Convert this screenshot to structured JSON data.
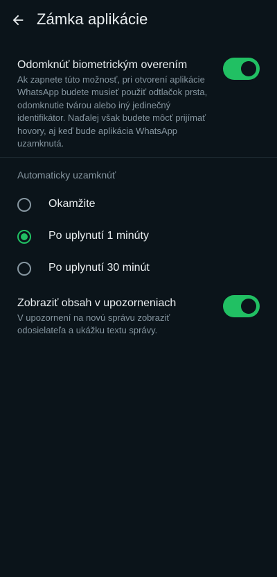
{
  "appbar": {
    "back_icon": "arrow-back-icon",
    "title": "Zámka aplikácie"
  },
  "biometric": {
    "title": "Odomknúť biometrickým overením",
    "description": "Ak zapnete túto možnosť, pri otvorení aplikácie WhatsApp budete musieť použiť odtlačok prsta, odomknutie tvárou alebo iný jedinečný identifikátor. Naďalej však budete môcť prijímať hovory, aj keď bude aplikácia WhatsApp uzamknutá.",
    "enabled": true
  },
  "auto_lock": {
    "header": "Automaticky uzamknúť",
    "options": [
      {
        "label": "Okamžite",
        "selected": false
      },
      {
        "label": "Po uplynutí 1 minúty",
        "selected": true
      },
      {
        "label": "Po uplynutí 30 minút",
        "selected": false
      }
    ]
  },
  "notifications": {
    "title": "Zobraziť obsah v upozorneniach",
    "description": "V upozornení na novú správu zobraziť odosielateľa a ukážku textu správy.",
    "enabled": true
  },
  "colors": {
    "background": "#0b141a",
    "accent": "#21c063",
    "primary_text": "#e9edef",
    "secondary_text": "#8696a0"
  }
}
